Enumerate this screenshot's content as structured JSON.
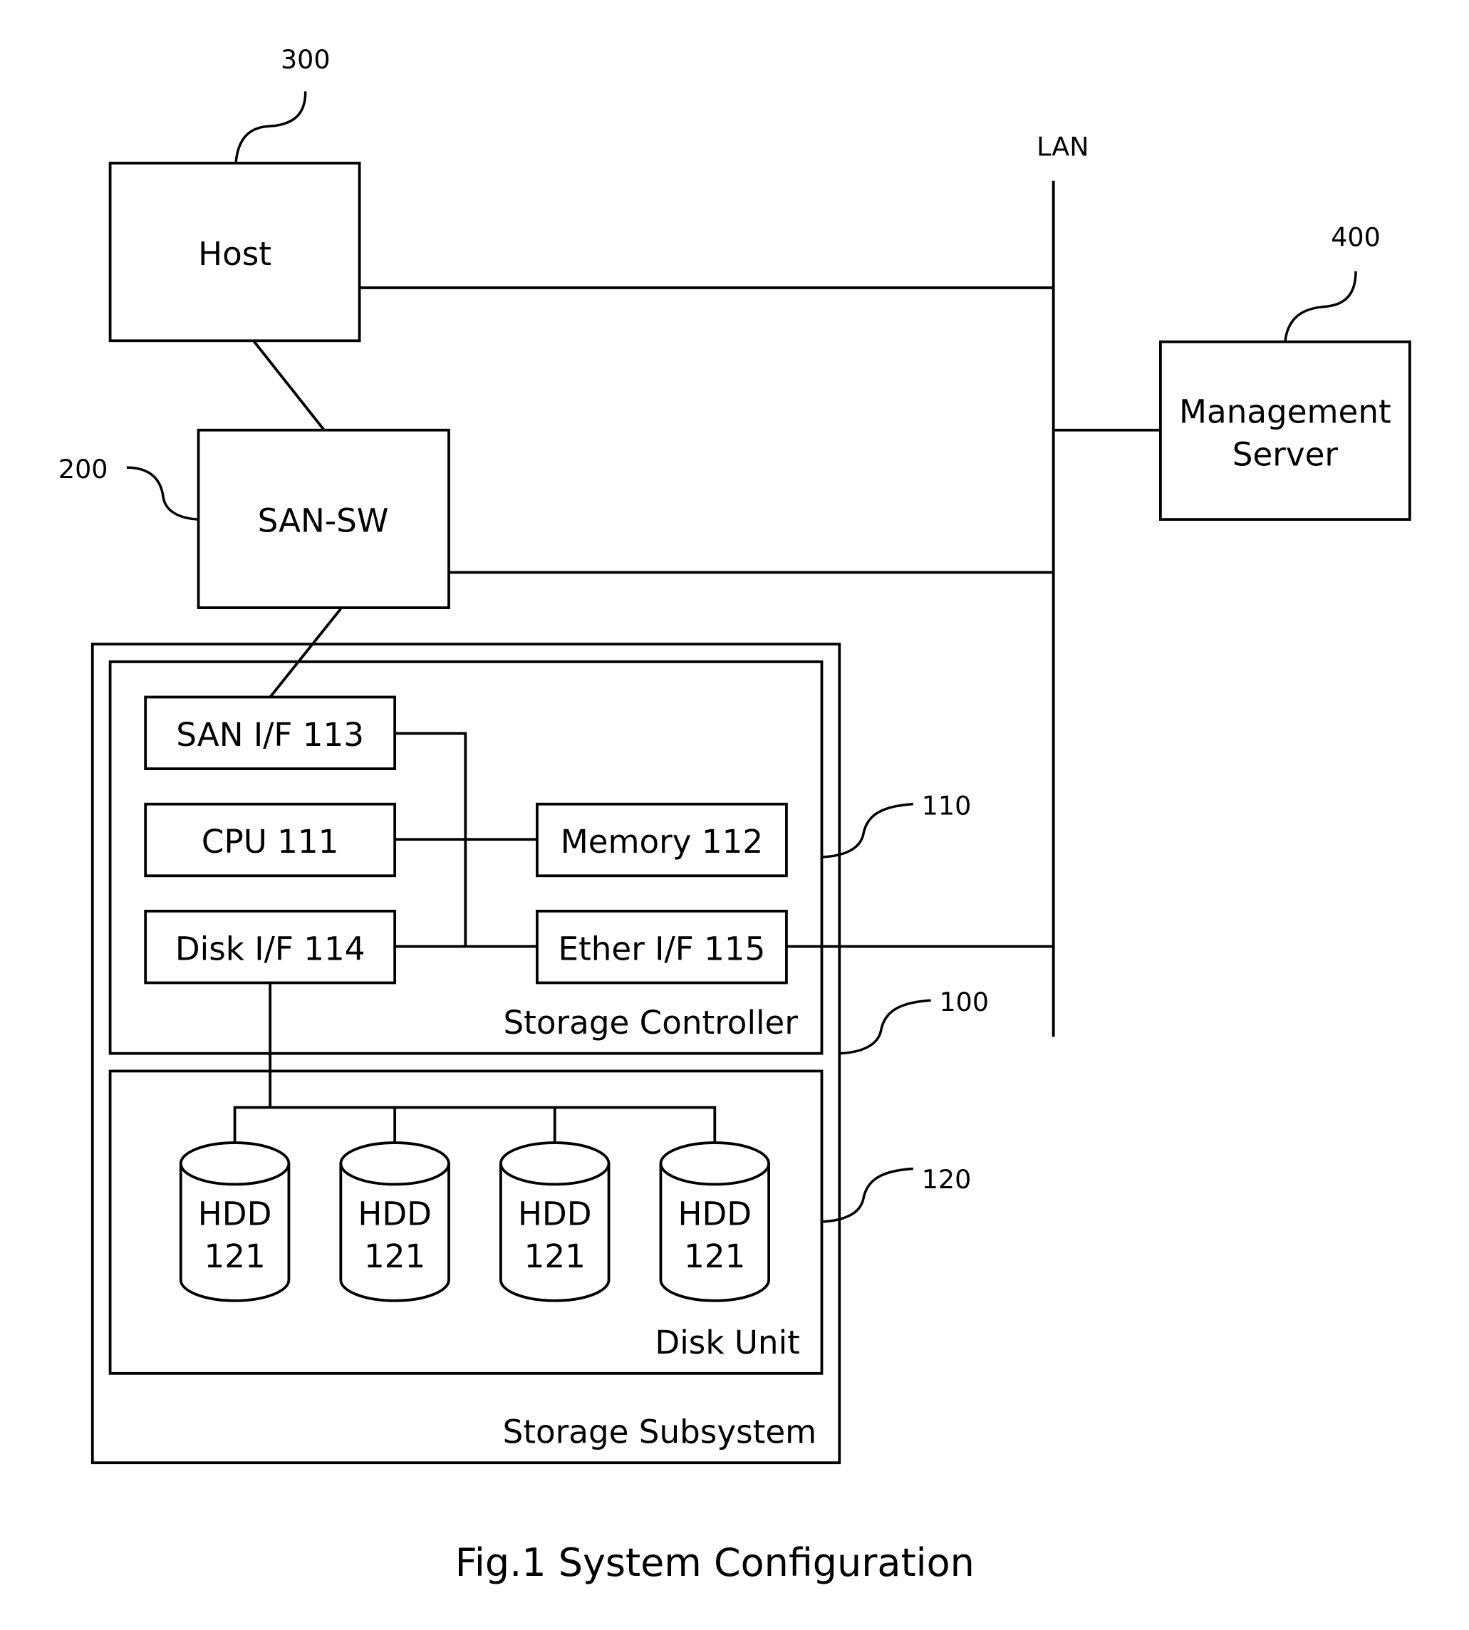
{
  "figure": {
    "caption": "Fig.1 System Configuration",
    "network_label": "LAN"
  },
  "nodes": {
    "host": {
      "label": "Host",
      "ref": "300"
    },
    "san_sw": {
      "label": "SAN-SW",
      "ref": "200"
    },
    "management_server": {
      "label_line1": "Management",
      "label_line2": "Server",
      "ref": "400"
    },
    "storage_subsystem": {
      "label": "Storage Subsystem",
      "ref": "100"
    },
    "storage_controller": {
      "label": "Storage Controller",
      "ref": "110",
      "components": {
        "san_if": "SAN I/F 113",
        "cpu": "CPU 111",
        "memory": "Memory 112",
        "disk_if": "Disk I/F 114",
        "ether_if": "Ether I/F 115"
      }
    },
    "disk_unit": {
      "label": "Disk Unit",
      "ref": "120",
      "hdds": [
        {
          "line1": "HDD",
          "line2": "121"
        },
        {
          "line1": "HDD",
          "line2": "121"
        },
        {
          "line1": "HDD",
          "line2": "121"
        },
        {
          "line1": "HDD",
          "line2": "121"
        }
      ]
    }
  },
  "colors": {
    "stroke": "#000000",
    "background": "#ffffff"
  }
}
